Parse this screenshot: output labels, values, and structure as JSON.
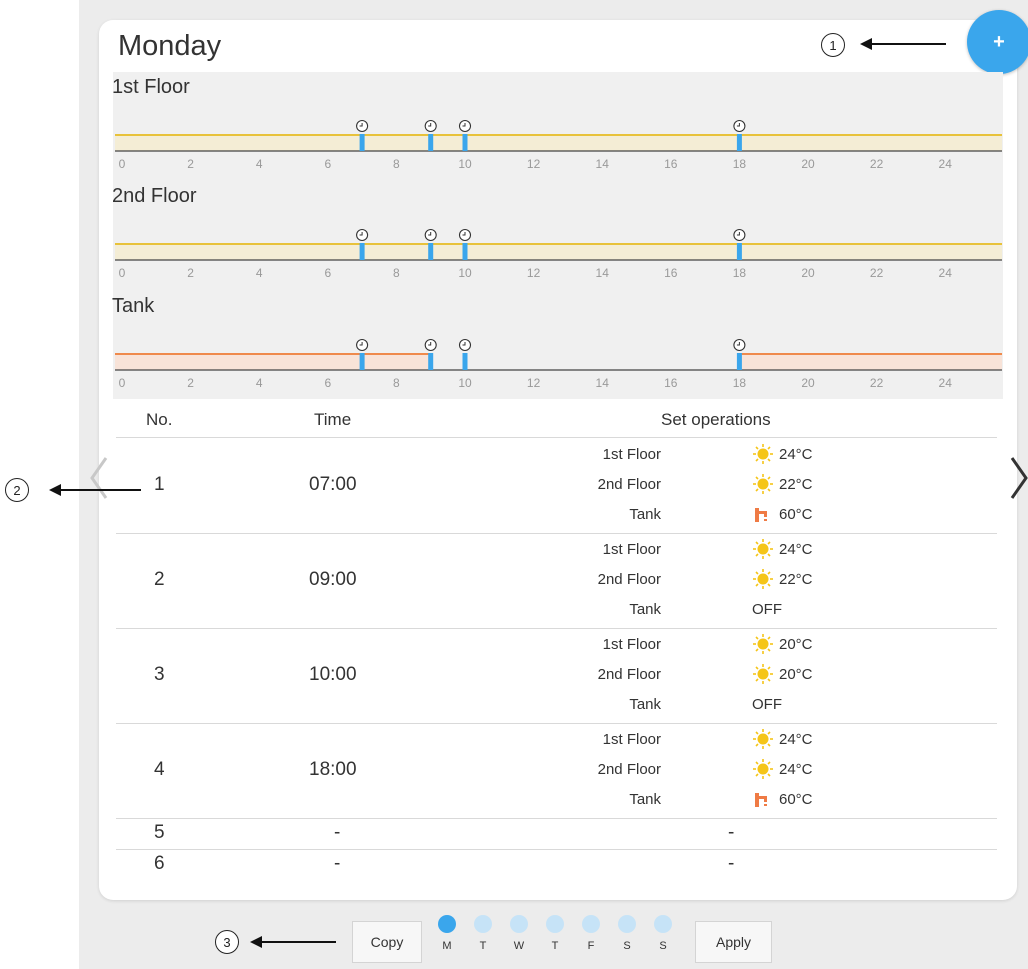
{
  "schedule": {
    "day_title": "Monday",
    "add_button_label": "+",
    "timelines": [
      {
        "label": "1st Floor",
        "style": "heating",
        "line_color": "#e8c23a",
        "fill_color": "#f4edd5"
      },
      {
        "label": "2nd Floor",
        "style": "heating",
        "line_color": "#e8c23a",
        "fill_color": "#f4edd5"
      },
      {
        "label": "Tank",
        "style": "tank",
        "line_color": "#ef8a4c",
        "fill_color": "#f8e3d8"
      }
    ],
    "hour_ticks": [
      "0",
      "2",
      "4",
      "6",
      "8",
      "10",
      "12",
      "14",
      "16",
      "18",
      "20",
      "22",
      "24"
    ],
    "event_hours": [
      7,
      9,
      10,
      18
    ],
    "tank_active": [
      [
        0,
        7
      ],
      [
        7,
        9
      ],
      [
        18,
        24
      ]
    ],
    "headers": {
      "no": "No.",
      "time": "Time",
      "ops": "Set operations"
    },
    "rows": [
      {
        "no": "1",
        "time": "07:00",
        "ops": [
          {
            "zone": "1st Floor",
            "icon": "sun-icon",
            "value": "24°C"
          },
          {
            "zone": "2nd Floor",
            "icon": "sun-icon",
            "value": "22°C"
          },
          {
            "zone": "Tank",
            "icon": "tap-icon",
            "value": "60°C"
          }
        ]
      },
      {
        "no": "2",
        "time": "09:00",
        "ops": [
          {
            "zone": "1st Floor",
            "icon": "sun-icon",
            "value": "24°C"
          },
          {
            "zone": "2nd Floor",
            "icon": "sun-icon",
            "value": "22°C"
          },
          {
            "zone": "Tank",
            "icon": "",
            "value": "OFF"
          }
        ]
      },
      {
        "no": "3",
        "time": "10:00",
        "ops": [
          {
            "zone": "1st Floor",
            "icon": "sun-icon",
            "value": "20°C"
          },
          {
            "zone": "2nd Floor",
            "icon": "sun-icon",
            "value": "20°C"
          },
          {
            "zone": "Tank",
            "icon": "",
            "value": "OFF"
          }
        ]
      },
      {
        "no": "4",
        "time": "18:00",
        "ops": [
          {
            "zone": "1st Floor",
            "icon": "sun-icon",
            "value": "24°C"
          },
          {
            "zone": "2nd Floor",
            "icon": "sun-icon",
            "value": "24°C"
          },
          {
            "zone": "Tank",
            "icon": "tap-icon",
            "value": "60°C"
          }
        ]
      },
      {
        "no": "5",
        "time": "-",
        "ops_text": "-"
      },
      {
        "no": "6",
        "time": "-",
        "ops_text": "-"
      }
    ]
  },
  "footer": {
    "copy_label": "Copy",
    "apply_label": "Apply",
    "days": [
      {
        "label": "M",
        "selected": true
      },
      {
        "label": "T",
        "selected": false
      },
      {
        "label": "W",
        "selected": false
      },
      {
        "label": "T",
        "selected": false
      },
      {
        "label": "F",
        "selected": false
      },
      {
        "label": "S",
        "selected": false
      },
      {
        "label": "S",
        "selected": false
      }
    ]
  },
  "callouts": [
    "1",
    "2",
    "3"
  ],
  "colors": {
    "accent": "#3aa6ec",
    "marker": "#3aa6ec",
    "dot_selected": "#3aa6ec",
    "dot_unselected": "#c6e3f7",
    "sun": "#f5c518",
    "tap": "#ef7b45"
  }
}
